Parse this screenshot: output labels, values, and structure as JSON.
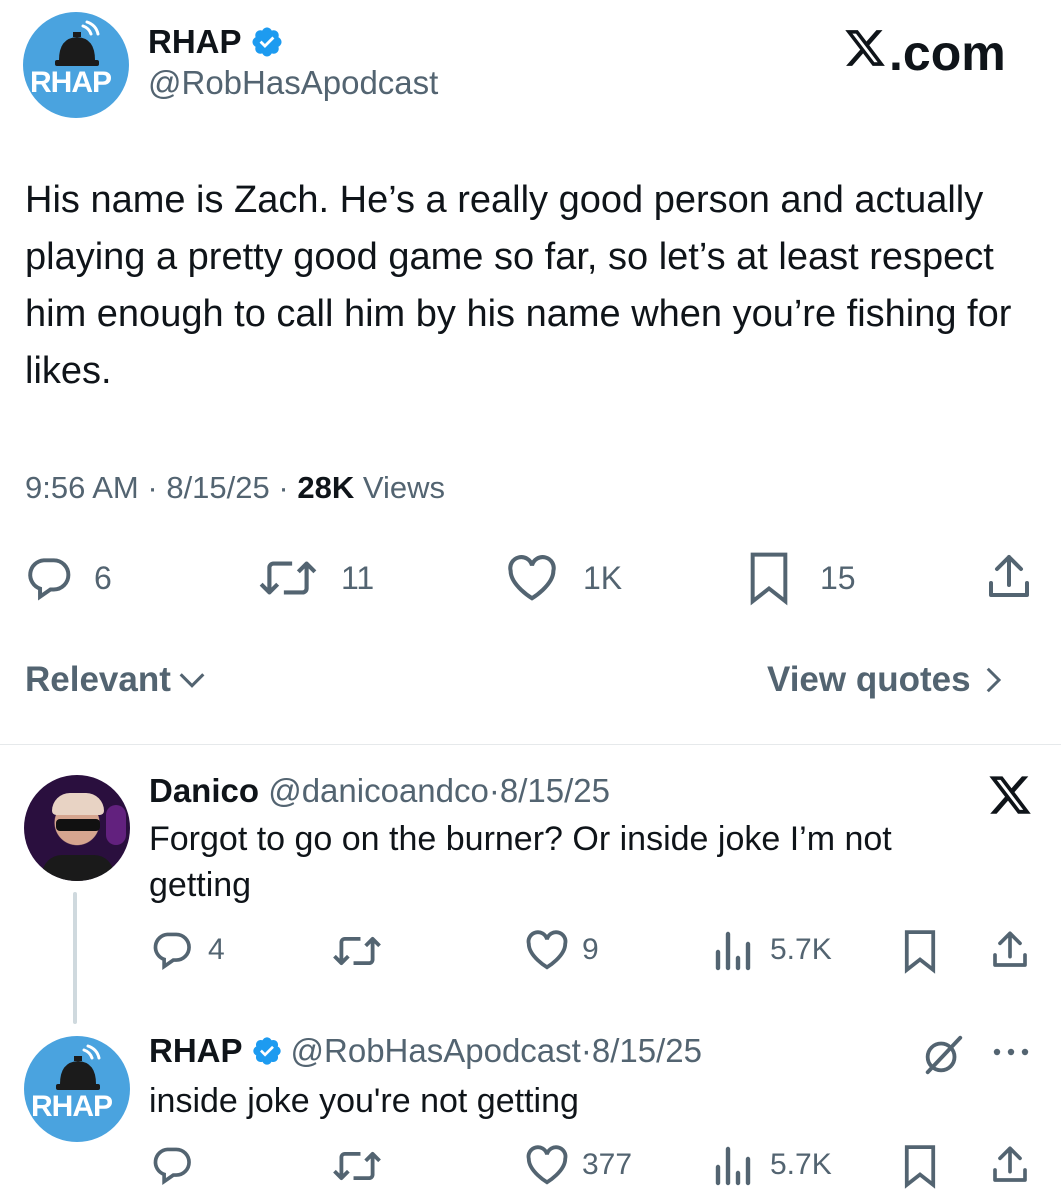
{
  "main_tweet": {
    "display_name": "RHAP",
    "handle": "@RobHasApodcast",
    "avatar_text": "RHAP",
    "watermark": "X.com",
    "body": "His name is Zach. He’s a really good person and actually playing a pretty good game so far, so let’s at least respect him enough to call him by his name when you’re fishing for likes.",
    "time": "9:56 AM",
    "date": "8/15/25",
    "views_count": "28K",
    "views_label": "Views",
    "separator": "·",
    "actions": {
      "replies": "6",
      "retweets": "11",
      "likes": "1K",
      "bookmarks": "15"
    }
  },
  "sort": {
    "label": "Relevant",
    "view_quotes": "View quotes"
  },
  "replies": [
    {
      "display_name": "Danico",
      "handle": "@danicoandco",
      "date": "8/15/25",
      "separator": "·",
      "body": "Forgot to go on the burner? Or inside joke I’m not getting",
      "actions": {
        "replies": "4",
        "retweets": "",
        "likes": "9",
        "views": "5.7K"
      }
    },
    {
      "display_name": "RHAP",
      "handle": "@RobHasApodcast",
      "date": "8/15/25",
      "separator": "·",
      "avatar_text": "RHAP",
      "body": "inside joke you're not getting",
      "actions": {
        "replies": "",
        "retweets": "",
        "likes": "377",
        "views": "5.7K"
      }
    }
  ],
  "colors": {
    "verified": "#1d9bf0",
    "grey": "#536471",
    "avatar_bg": "#4aa3df"
  },
  "icons": [
    "bell-icon",
    "verified-badge-icon",
    "x-logo-icon",
    "reply-icon",
    "retweet-icon",
    "like-icon",
    "bookmark-icon",
    "share-icon",
    "chevron-down-icon",
    "chevron-right-icon",
    "views-icon",
    "grok-icon",
    "more-icon"
  ]
}
